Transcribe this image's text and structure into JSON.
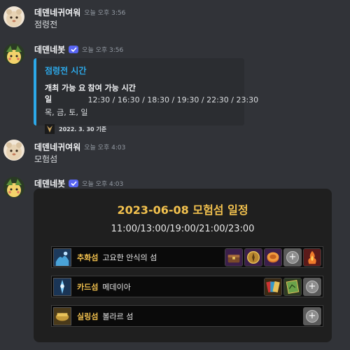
{
  "messages": [
    {
      "username": "데덴네귀여워",
      "timestamp": "오늘 오후 3:56",
      "text": "점령전"
    },
    {
      "username": "데덴네봇",
      "timestamp": "오늘 오후 3:56"
    },
    {
      "username": "데덴네귀여워",
      "timestamp": "오늘 오후 4:03",
      "text": "모험섬"
    },
    {
      "username": "데덴네봇",
      "timestamp": "오늘 오후 4:03"
    }
  ],
  "embed1": {
    "title": "점령전 시간",
    "field1_name": "개최 가능 요일",
    "field1_value": "목, 금, 토, 일",
    "field2_name": "참여 가능 시간",
    "field2_value": "12:30 / 16:30 / 18:30 / 19:30 / 22:30 / 23:30",
    "footer": "2022. 3. 30 기준",
    "accent": "#2ca8e8"
  },
  "card": {
    "title": "2023-06-08 모험섬 일정",
    "times": "11:00/13:00/19:00/21:00/23:00",
    "islands": [
      {
        "type": "추화섬",
        "name": "고요한 안식의 섬",
        "rewards": [
          "chest-icon",
          "compass-icon",
          "coin-icon",
          "plus-icon",
          "flame-card-icon"
        ]
      },
      {
        "type": "카드섬",
        "name": "메데이아",
        "rewards": [
          "card-pack-icon",
          "map-card-icon",
          "plus-icon"
        ]
      },
      {
        "type": "실링섬",
        "name": "볼라르 섬",
        "rewards": [
          "plus-icon"
        ]
      }
    ]
  }
}
